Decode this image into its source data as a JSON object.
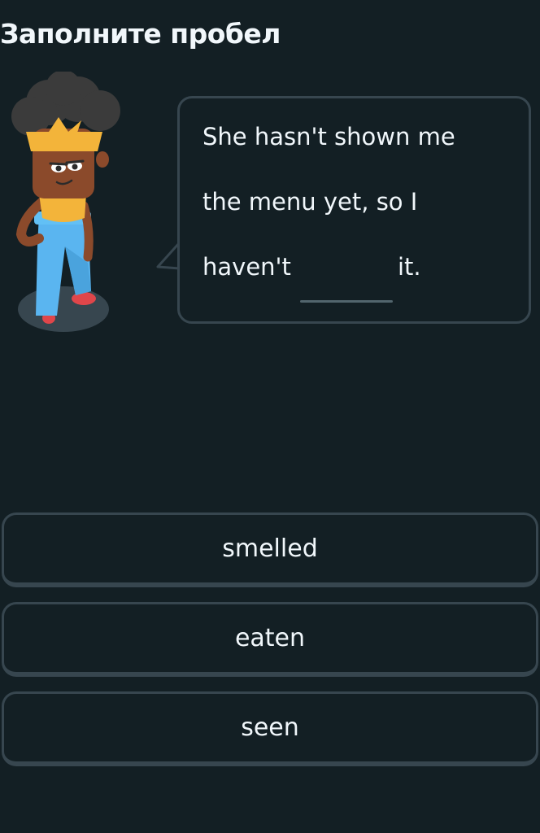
{
  "header": {
    "title": "Заполните пробел"
  },
  "prompt": {
    "line1": "She hasn't shown me",
    "line2": "the menu yet, so I",
    "line3_start": "haven't",
    "line3_end": "it."
  },
  "options": [
    {
      "label": "smelled"
    },
    {
      "label": "eaten"
    },
    {
      "label": "seen"
    }
  ],
  "colors": {
    "background": "#131f24",
    "border": "#37464f",
    "text": "#f1f7fb",
    "blank": "#52656d"
  }
}
